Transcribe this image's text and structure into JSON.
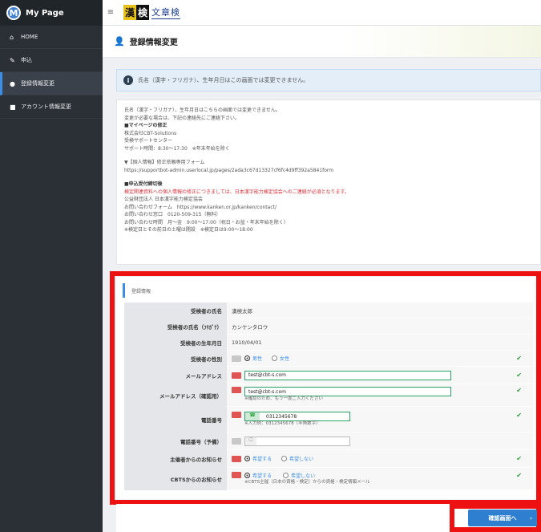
{
  "sidebar": {
    "brand_initial": "M",
    "brand_name": "My Page",
    "items": [
      {
        "label": "HOME",
        "icon": "home-icon"
      },
      {
        "label": "申込",
        "icon": "pencil-icon"
      },
      {
        "label": "登録情報変更",
        "icon": "user-icon"
      },
      {
        "label": "アカウント情報変更",
        "icon": "lock-icon"
      }
    ],
    "active_index": 2
  },
  "topbar": {
    "menu_icon": "≡",
    "logo_a": "漢",
    "logo_b": "検",
    "logo_c": "文章検"
  },
  "page": {
    "title": "登録情報変更"
  },
  "alert": {
    "text": "氏名（漢字・フリガナ）、生年月日はこの画面では変更できません。"
  },
  "notice": {
    "l1": "氏名（漢字・フリガナ）、生年月日はこちらの画面では変更できません。",
    "l2": "変更が必要な場合は、下記の連絡先にご連絡下さい。",
    "h1": "■マイページの修正",
    "l3": "株式会社CBT-Solutions",
    "l4": "受検サポートセンター",
    "l5": "サポート時間：8:30～17:30　※年末年始を除く",
    "l6": "▼【個人情報】修正依頼専用フォーム",
    "l7": "https://supportbot-admin.userlocal.jp/pages/2ada3c67d13327cf6fc4d9ff392a5841form",
    "h2": "■申込受付締切後",
    "red": "検定関連資料への個人情報の修正につきましては、日本漢字能力検定協会へのご連絡が必須となります。",
    "l8": "公益財団法人 日本漢字能力検定協会",
    "l9": "お問い合わせフォーム　https://www.kanken.or.jp/kanken/contact/",
    "l10": "お問い合わせ窓口　0120-509-315（無料）",
    "l11": "お問い合わせ時間　月～金　9:00～17:00（祝日・お盆・年末年始を除く）",
    "l12": "※検定日とその前日の土曜は開設　※検定日は9:00～18:00"
  },
  "form": {
    "section_title": "登録情報",
    "name_label": "受検者の氏名",
    "name_value": "漢検太郎",
    "kana_label": "受検者の氏名（ﾌﾘｶﾞﾅ）",
    "kana_value": "カンケンタロウ",
    "dob_label": "受検者の生年月日",
    "dob_value": "1910/04/01",
    "gender_label": "受検者の性別",
    "gender_male": "男性",
    "gender_female": "女性",
    "email_label": "メールアドレス",
    "email_value": "test@cbt-s.com",
    "email2_label": "メールアドレス（確認用）",
    "email2_value": "test@cbt-s.com",
    "email2_hint": "※確認のため、もう一度ご入力ください",
    "phone_label": "電話番号",
    "phone_value": "0312345678",
    "phone_hint": "※入力例：0312345678（半角数字）",
    "phone2_label": "電話番号（予備）",
    "notice1_label": "主催者からのお知らせ",
    "opt_yes": "希望する",
    "opt_no": "希望しない",
    "notice2_label": "CBTSからのお知らせ",
    "notice2_hint": "※CBTS主催（日本の資格・検定）からの資格・検定情報メール"
  },
  "confirm_label": "確認画面へ",
  "colors": {
    "accent": "#2f7fd1",
    "required": "#e05454",
    "highlight": "#ee1111",
    "ok": "#2e9e3a"
  }
}
